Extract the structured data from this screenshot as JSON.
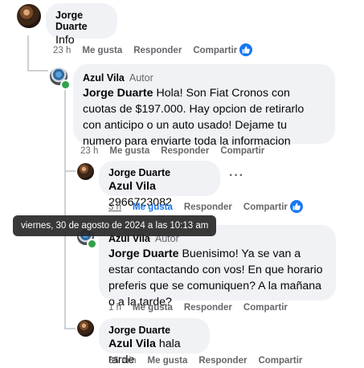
{
  "comments": [
    {
      "author": "Jorge Duarte",
      "text": "Info",
      "time": "23 h",
      "like": "Me gusta",
      "reply": "Responder",
      "share": "Compartir"
    },
    {
      "author": "Azul Vila",
      "badge": "Autor",
      "mention": "Jorge Duarte",
      "text": " Hola! Son Fiat Cronos con cuotas de $197.000. Hay opcion de retirarlo con anticipo o un auto usado! Dejame tu numero para enviarte toda la informacion",
      "time": "23 h",
      "like": "Me gusta",
      "reply": "Responder",
      "share": "Compartir"
    },
    {
      "author": "Jorge Duarte",
      "mention": "Azul Vila",
      "text": " 2966723082",
      "time": "3 h",
      "like": "Me gusta",
      "reply": "Responder",
      "share": "Compartir"
    },
    {
      "author": "Azul Vila",
      "badge": "Autor",
      "mention": "Jorge Duarte",
      "text": " Buenisimo! Ya se van a estar contactando con vos! En que horario preferis que se comuniquen? A la mañana o a la tarde?",
      "time": "1 h",
      "like": "Me gusta",
      "reply": "Responder",
      "share": "Compartir"
    },
    {
      "author": "Jorge Duarte",
      "mention": "Azul Vila",
      "text": " hala tarde",
      "time": "36 min",
      "like": "Me gusta",
      "reply": "Responder",
      "share": "Compartir"
    }
  ],
  "tooltip": "viernes, 30 de agosto de 2024 a las 10:13 am",
  "colors": {
    "like_blue": "#1877f2",
    "online_green": "#31a24c",
    "bubble": "#f0f2f5"
  }
}
